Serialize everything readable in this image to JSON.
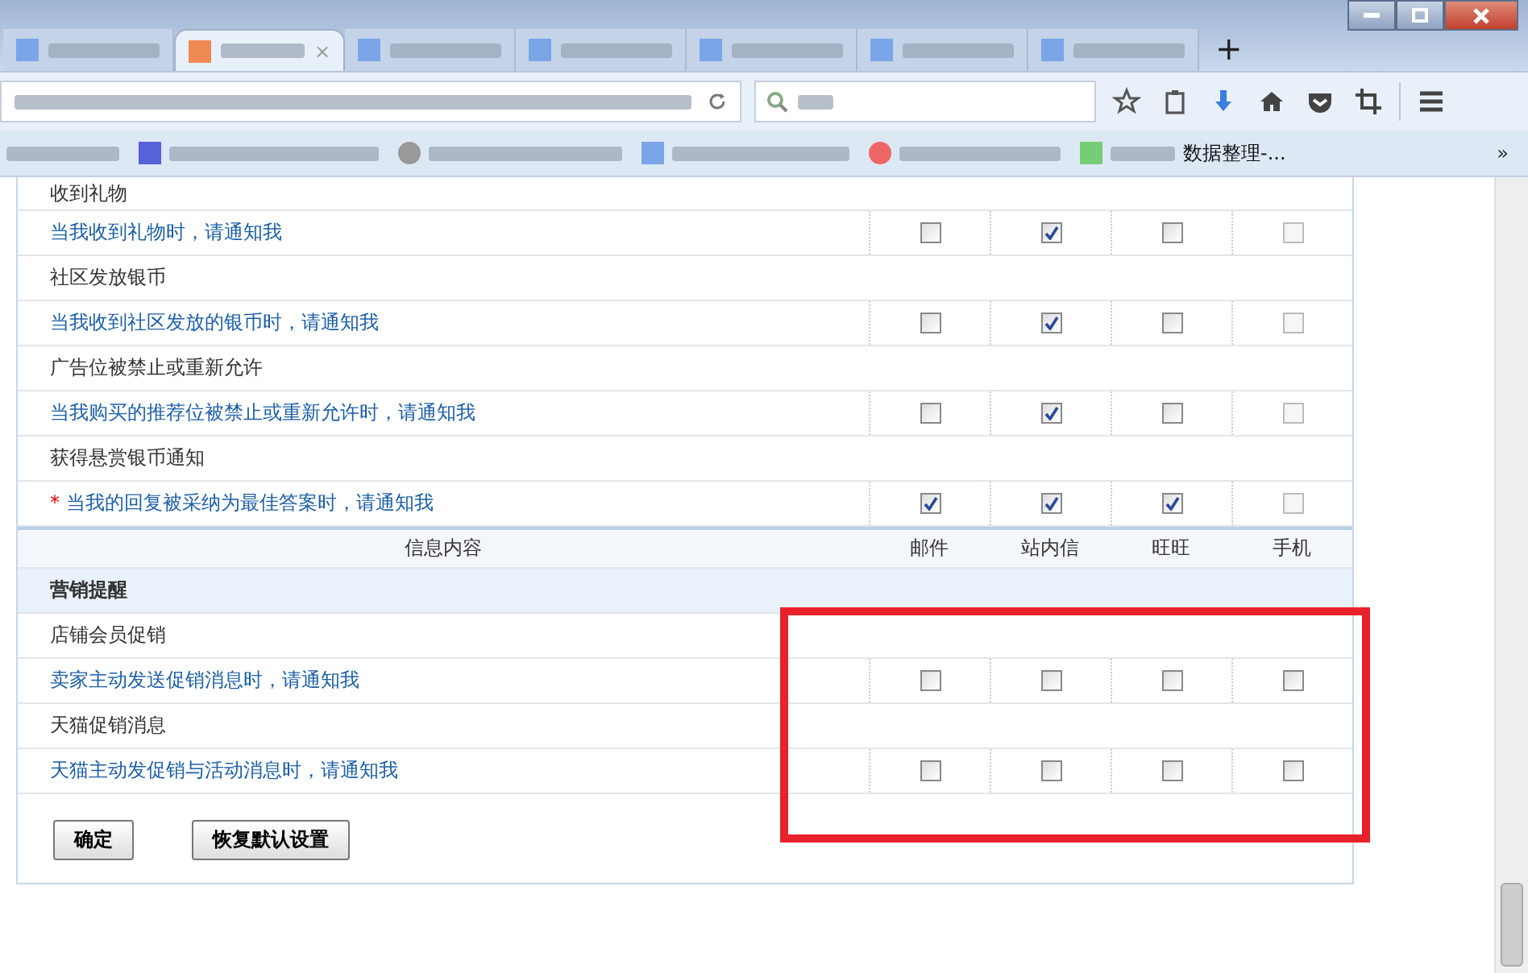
{
  "tab_bar": {
    "tabs": [
      {
        "selected": false
      },
      {
        "selected": true
      },
      {
        "selected": false
      },
      {
        "selected": false
      },
      {
        "selected": false
      },
      {
        "selected": false
      },
      {
        "selected": false
      }
    ],
    "new_tab": "+",
    "close_label": "×"
  },
  "bookmarks": {
    "last_item": "数据整理-...",
    "overflow": "»"
  },
  "table": {
    "required_mark": "*",
    "rows": [
      {
        "kind": "category",
        "label": "收到礼物"
      },
      {
        "kind": "option",
        "label": "当我收到礼物时，请通知我",
        "required": false,
        "options": [
          {
            "checked": false,
            "disabled": false
          },
          {
            "checked": true,
            "disabled": false
          },
          {
            "checked": false,
            "disabled": false
          },
          {
            "checked": false,
            "disabled": true
          }
        ]
      },
      {
        "kind": "category",
        "label": "社区发放银币"
      },
      {
        "kind": "option",
        "label": "当我收到社区发放的银币时，请通知我",
        "required": false,
        "options": [
          {
            "checked": false,
            "disabled": false
          },
          {
            "checked": true,
            "disabled": false
          },
          {
            "checked": false,
            "disabled": false
          },
          {
            "checked": false,
            "disabled": true
          }
        ]
      },
      {
        "kind": "category",
        "label": "广告位被禁止或重新允许"
      },
      {
        "kind": "option",
        "label": "当我购买的推荐位被禁止或重新允许时，请通知我",
        "required": false,
        "options": [
          {
            "checked": false,
            "disabled": false
          },
          {
            "checked": true,
            "disabled": false
          },
          {
            "checked": false,
            "disabled": false
          },
          {
            "checked": false,
            "disabled": true
          }
        ]
      },
      {
        "kind": "category",
        "label": "获得悬赏银币通知"
      },
      {
        "kind": "option",
        "label": "当我的回复被采纳为最佳答案时，请通知我",
        "required": true,
        "options": [
          {
            "checked": true,
            "disabled": false
          },
          {
            "checked": true,
            "disabled": false
          },
          {
            "checked": true,
            "disabled": false
          },
          {
            "checked": false,
            "disabled": true
          }
        ]
      },
      {
        "kind": "header",
        "columns": [
          "信息内容",
          "邮件",
          "站内信",
          "旺旺",
          "手机"
        ]
      },
      {
        "kind": "section",
        "label": "营销提醒"
      },
      {
        "kind": "category",
        "label": "店铺会员促销"
      },
      {
        "kind": "option",
        "label": "卖家主动发送促销消息时，请通知我",
        "required": false,
        "options": [
          {
            "checked": false,
            "disabled": false
          },
          {
            "checked": false,
            "disabled": false
          },
          {
            "checked": false,
            "disabled": false
          },
          {
            "checked": false,
            "disabled": false
          }
        ]
      },
      {
        "kind": "category",
        "label": "天猫促销消息"
      },
      {
        "kind": "option",
        "label": "天猫主动发促销与活动消息时，请通知我",
        "required": false,
        "options": [
          {
            "checked": false,
            "disabled": false
          },
          {
            "checked": false,
            "disabled": false
          },
          {
            "checked": false,
            "disabled": false
          },
          {
            "checked": false,
            "disabled": false
          }
        ]
      }
    ]
  },
  "buttons": [
    "确定",
    "恢复默认设置"
  ]
}
